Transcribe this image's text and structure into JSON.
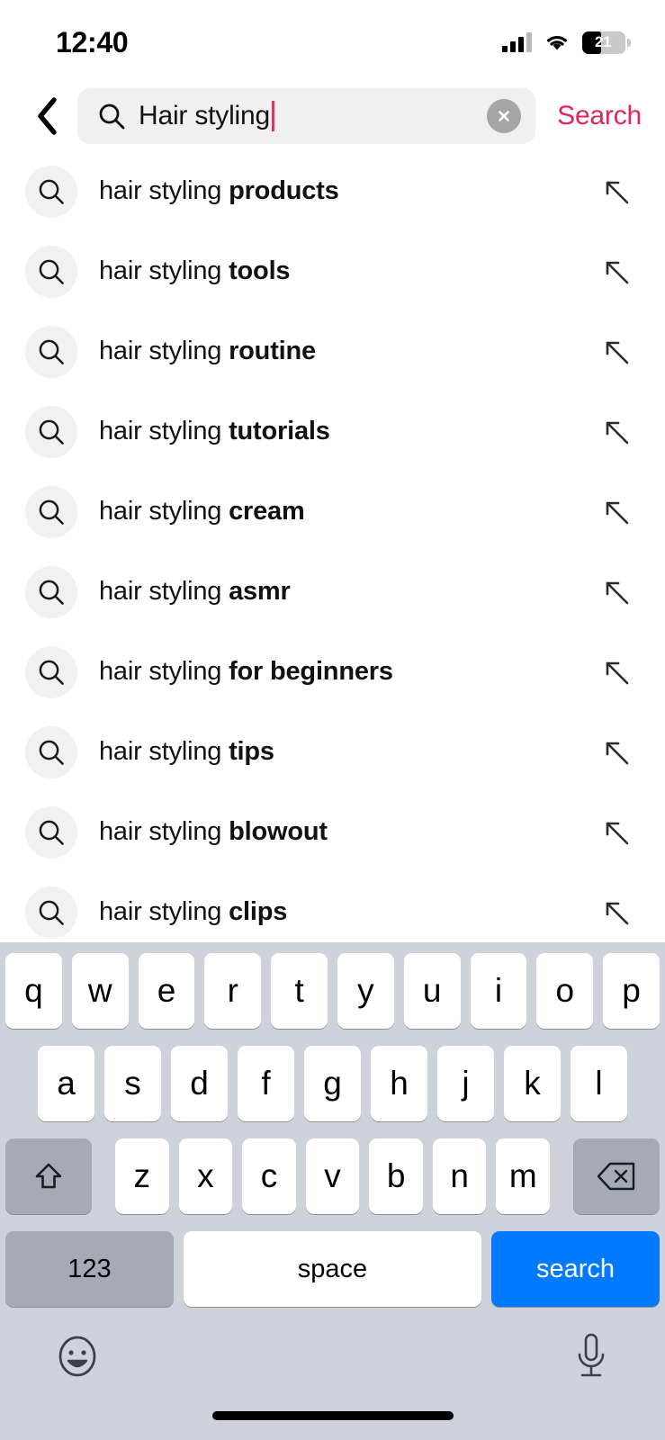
{
  "status_bar": {
    "time": "12:40",
    "battery_level": "21",
    "cellular_icon": "cellular-signal-icon",
    "wifi_icon": "wifi-icon",
    "battery_icon": "battery-icon"
  },
  "header": {
    "back_icon": "chevron-left-icon",
    "search_icon": "search-icon",
    "query_value": "Hair styling",
    "query_placeholder": "Search",
    "clear_icon": "clear-circle-icon",
    "search_action_label": "Search",
    "accent_color": "#e0245e",
    "caret_color": "#e8305e"
  },
  "suggestions": {
    "row_icon": "search-icon",
    "row_arrow_icon": "arrow-up-left-icon",
    "prefix": "hair styling ",
    "items": [
      {
        "prefix": "hair styling ",
        "bold": "products"
      },
      {
        "prefix": "hair styling ",
        "bold": "tools"
      },
      {
        "prefix": "hair styling ",
        "bold": "routine"
      },
      {
        "prefix": "hair styling ",
        "bold": "tutorials"
      },
      {
        "prefix": "hair styling ",
        "bold": "cream"
      },
      {
        "prefix": "hair styling ",
        "bold": "asmr"
      },
      {
        "prefix": "hair styling ",
        "bold": "for beginners"
      },
      {
        "prefix": "hair styling ",
        "bold": "tips"
      },
      {
        "prefix": "hair styling ",
        "bold": "blowout"
      },
      {
        "prefix": "hair styling ",
        "bold": "clips"
      }
    ]
  },
  "keyboard": {
    "row1": [
      "q",
      "w",
      "e",
      "r",
      "t",
      "y",
      "u",
      "i",
      "o",
      "p"
    ],
    "row2": [
      "a",
      "s",
      "d",
      "f",
      "g",
      "h",
      "j",
      "k",
      "l"
    ],
    "row3": [
      "z",
      "x",
      "c",
      "v",
      "b",
      "n",
      "m"
    ],
    "shift_icon": "shift-arrow-up-icon",
    "delete_icon": "backspace-delete-icon",
    "numbers_label": "123",
    "space_label": "space",
    "return_label": "search",
    "return_color": "#007aff",
    "emoji_icon": "emoji-smiley-icon",
    "dictation_icon": "microphone-icon",
    "background_color": "#ced3db"
  }
}
